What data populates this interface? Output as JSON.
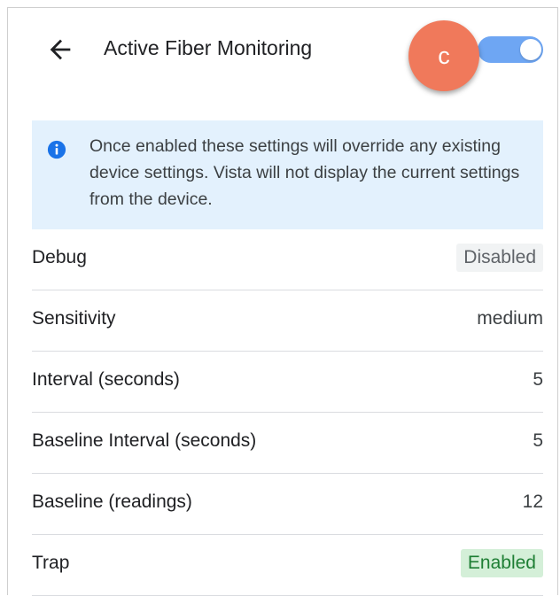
{
  "header": {
    "title": "Active Fiber Monitoring",
    "back_icon": "arrow-left-icon",
    "step_marker": "c",
    "toggle_on": true
  },
  "colors": {
    "accent": "#6ea6f3",
    "marker": "#f0795b",
    "info_bg": "#e3f1fd",
    "info_icon": "#1a73e8",
    "enabled_bg": "#d4efd8",
    "enabled_text": "#1e7e34",
    "disabled_bg": "#f1f3f4"
  },
  "info": {
    "icon": "info-icon",
    "text": "Once enabled these settings will override any existing device settings. Vista will not display the current settings from the device."
  },
  "settings": [
    {
      "label": "Debug",
      "value": "Disabled"
    },
    {
      "label": "Sensitivity",
      "value": "medium"
    },
    {
      "label": "Interval (seconds)",
      "value": "5"
    },
    {
      "label": "Baseline Interval (seconds)",
      "value": "5"
    },
    {
      "label": "Baseline (readings)",
      "value": "12"
    },
    {
      "label": "Trap",
      "value": "Enabled"
    }
  ]
}
